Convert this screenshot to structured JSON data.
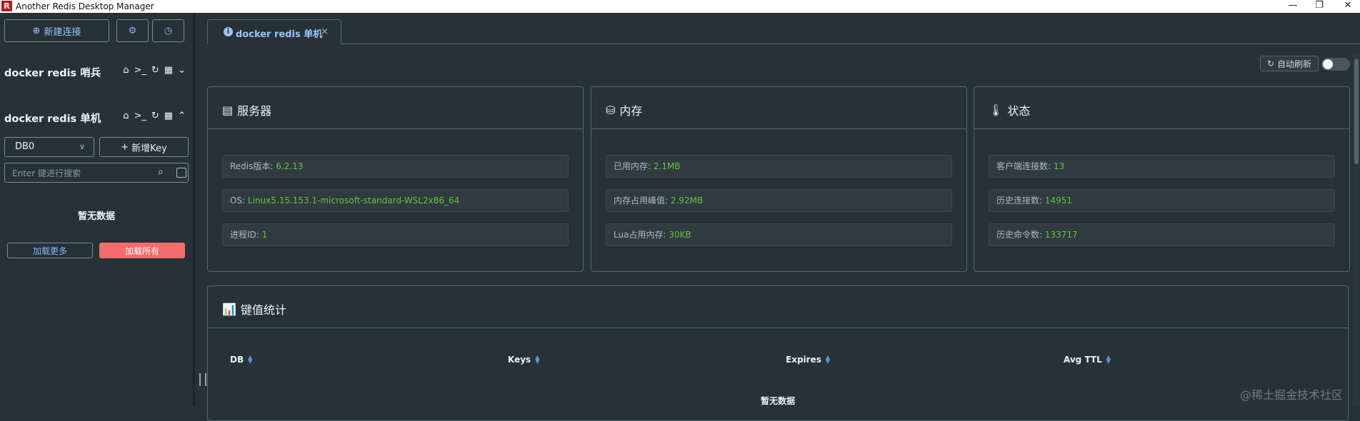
{
  "window": {
    "title": "Another Redis Desktop Manager",
    "minimize": "—",
    "restore": "❐",
    "close": "✕"
  },
  "sidebar": {
    "new_connection": "新建连接",
    "connections": [
      {
        "name": "docker redis 哨兵"
      },
      {
        "name": "docker redis 单机"
      }
    ],
    "db_select": "DB0",
    "add_key": "新增Key",
    "search_placeholder": "Enter 键进行搜索",
    "empty_text": "暂无数据",
    "load_more": "加载更多",
    "load_all": "加载所有"
  },
  "tab": {
    "label": "docker redis 单机",
    "close": "×"
  },
  "toolbar": {
    "auto_refresh": "自动刷新",
    "auto_refresh_enabled": false
  },
  "server": {
    "title": "服务器",
    "rows": [
      {
        "label": "Redis版本: ",
        "value": "6.2.13"
      },
      {
        "label": "OS: ",
        "value": "Linux5.15.153.1-microsoft-standard-WSL2x86_64"
      },
      {
        "label": "进程ID: ",
        "value": "1"
      }
    ]
  },
  "memory": {
    "title": "内存",
    "rows": [
      {
        "label": "已用内存: ",
        "value": "2.1MB"
      },
      {
        "label": "内存占用峰值: ",
        "value": "2.92MB"
      },
      {
        "label": "Lua占用内存: ",
        "value": "30KB"
      }
    ]
  },
  "status": {
    "title": "状态",
    "rows": [
      {
        "label": "客户端连接数: ",
        "value": "13"
      },
      {
        "label": "历史连接数: ",
        "value": "14951"
      },
      {
        "label": "历史命令数: ",
        "value": "133717"
      }
    ]
  },
  "key_stats": {
    "title": "键值统计",
    "columns": [
      "DB",
      "Keys",
      "Expires",
      "Avg TTL"
    ],
    "empty_text": "暂无数据"
  },
  "watermark": "@稀土掘金技术社区",
  "colors": {
    "accent": "#8ab4f8",
    "value_green": "#67c23a",
    "danger": "#f56c6c",
    "background": "#263238"
  }
}
